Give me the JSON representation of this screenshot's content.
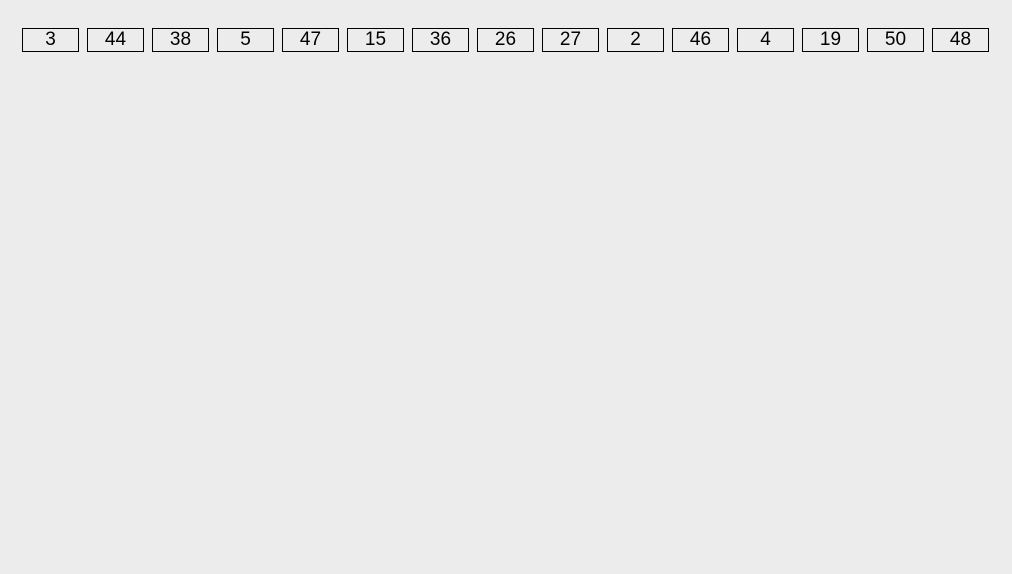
{
  "buttons": [
    {
      "label": "3"
    },
    {
      "label": "44"
    },
    {
      "label": "38"
    },
    {
      "label": "5"
    },
    {
      "label": "47"
    },
    {
      "label": "15"
    },
    {
      "label": "36"
    },
    {
      "label": "26"
    },
    {
      "label": "27"
    },
    {
      "label": "2"
    },
    {
      "label": "46"
    },
    {
      "label": "4"
    },
    {
      "label": "19"
    },
    {
      "label": "50"
    },
    {
      "label": "48"
    }
  ]
}
